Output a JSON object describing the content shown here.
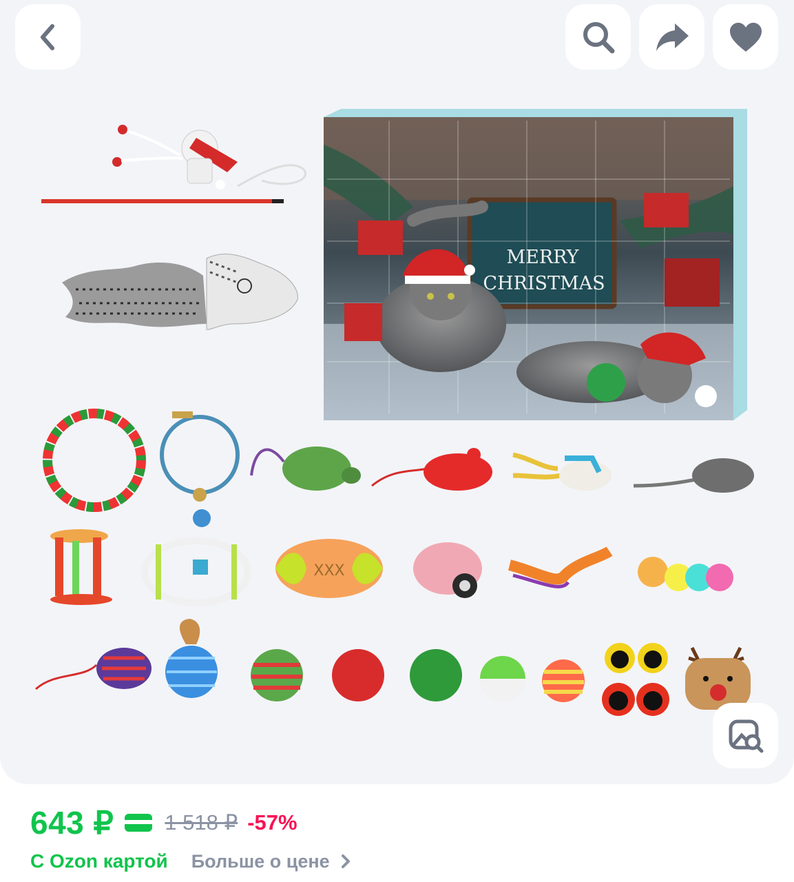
{
  "topbar": {
    "back_icon": "chevron-left-icon",
    "search_icon": "search-icon",
    "share_icon": "share-arrow-icon",
    "favorite_icon": "heart-icon"
  },
  "product_image": {
    "box_text_line1": "MERRY",
    "box_text_line2": "CHRISTMAS",
    "lens_icon": "image-search-icon"
  },
  "pricing": {
    "price": "643 ₽",
    "old_price": "1 518 ₽",
    "discount": "-57%",
    "card_label": "С Ozon картой",
    "more_price_label": "Больше о цене",
    "accent_color": "#10c44c",
    "discount_color": "#f91155"
  }
}
